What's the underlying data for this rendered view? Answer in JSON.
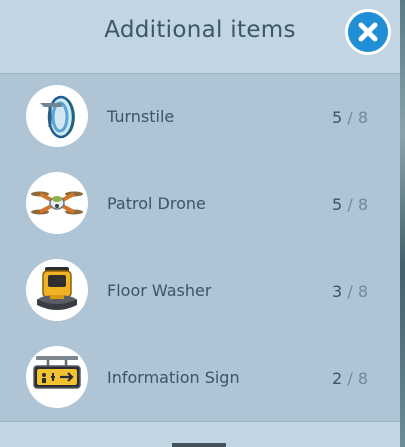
{
  "title": "Additional items",
  "close_icon": "close-icon",
  "colors": {
    "accent": "#1f8fd6",
    "panel": "#afc4d4",
    "header": "#c1d5e3",
    "text": "#3b5566"
  },
  "items": [
    {
      "name": "Turnstile",
      "have": "5",
      "sep": "/",
      "max": "8",
      "icon": "turnstile-icon"
    },
    {
      "name": "Patrol Drone",
      "have": "5",
      "sep": "/",
      "max": "8",
      "icon": "patrol-drone-icon"
    },
    {
      "name": "Floor Washer",
      "have": "3",
      "sep": "/",
      "max": "8",
      "icon": "floor-washer-icon"
    },
    {
      "name": "Information Sign",
      "have": "2",
      "sep": "/",
      "max": "8",
      "icon": "information-sign-icon"
    }
  ]
}
